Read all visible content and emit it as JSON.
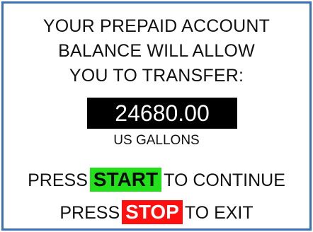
{
  "screen": {
    "message_lines": [
      "YOUR PREPAID ACCOUNT",
      "BALANCE WILL ALLOW",
      "YOU TO TRANSFER:"
    ],
    "balance": "24680.00",
    "unit": "US GALLONS"
  },
  "prompts": {
    "continue": {
      "prefix": "PRESS",
      "key": "START",
      "suffix": "TO CONTINUE"
    },
    "exit": {
      "prefix": "PRESS",
      "key": "STOP",
      "suffix": "TO EXIT"
    }
  },
  "colors": {
    "frame": "#3b6fb6",
    "start_key": "#22e01a",
    "stop_key": "#ff1010",
    "balance_bg": "#000000"
  }
}
